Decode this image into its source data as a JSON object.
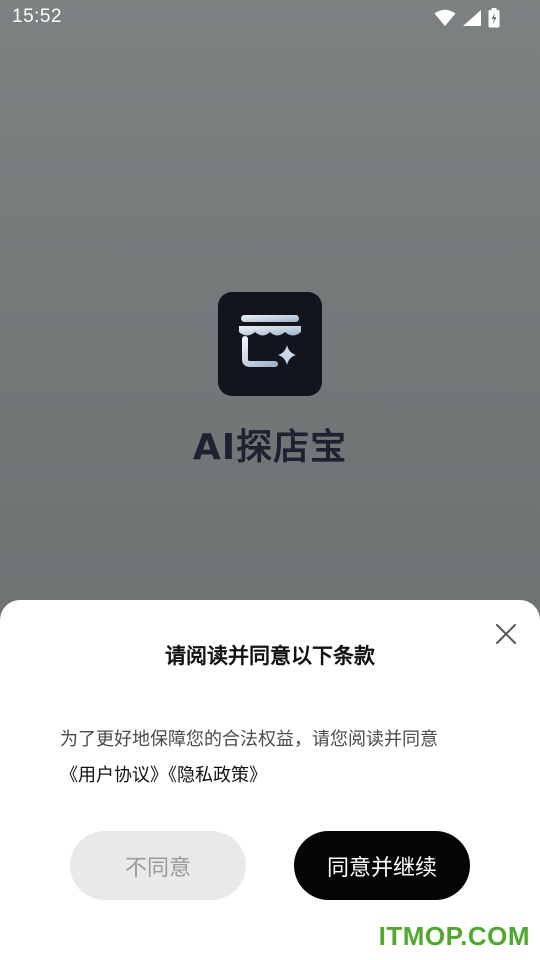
{
  "status_bar": {
    "time": "15:52",
    "icons": [
      "wifi-icon",
      "signal-icon",
      "battery-charging-icon"
    ]
  },
  "app": {
    "name": "AI探店宝",
    "logo_icon": "storefront-sparkle-icon",
    "logo_bg": "#12161c"
  },
  "dialog": {
    "title": "请阅读并同意以下条款",
    "body_text": "为了更好地保障您的合法权益，请您阅读并同意",
    "links": {
      "user_agreement": "《用户协议》",
      "privacy_policy": "《隐私政策》"
    },
    "buttons": {
      "disagree": "不同意",
      "agree": "同意并继续"
    },
    "close_icon": "close-icon"
  },
  "watermark": "ITMOP.COM",
  "colors": {
    "agree_button_bg": "#050505",
    "disagree_button_bg": "#e9e9e9",
    "watermark": "#4fa82f"
  }
}
